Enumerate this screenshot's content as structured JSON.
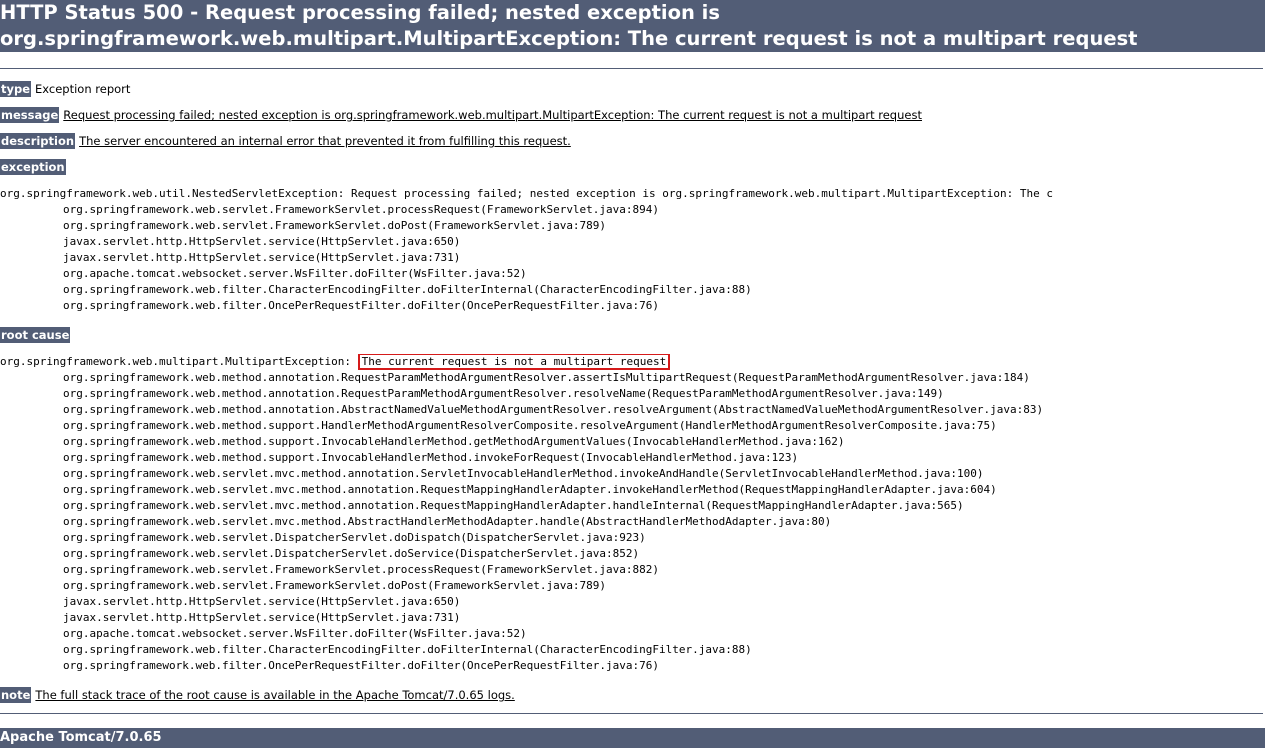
{
  "header": {
    "title_line1": "HTTP Status 500 - Request processing failed; nested exception is",
    "title_line2": "org.springframework.web.multipart.MultipartException: The current request is not a multipart request"
  },
  "report": {
    "type_label": "type",
    "type_value": "Exception report",
    "message_label": "message",
    "message_value": "Request processing failed; nested exception is org.springframework.web.multipart.MultipartException: The current request is not a multipart request",
    "description_label": "description",
    "description_value": "The server encountered an internal error that prevented it from fulfilling this request.",
    "exception_label": "exception",
    "root_cause_label": "root cause",
    "note_label": "note",
    "note_value": "The full stack trace of the root cause is available in the Apache Tomcat/7.0.65 logs."
  },
  "exception": {
    "first_line": "org.springframework.web.util.NestedServletException: Request processing failed; nested exception is org.springframework.web.multipart.MultipartException: The c",
    "frames": [
      "org.springframework.web.servlet.FrameworkServlet.processRequest(FrameworkServlet.java:894)",
      "org.springframework.web.servlet.FrameworkServlet.doPost(FrameworkServlet.java:789)",
      "javax.servlet.http.HttpServlet.service(HttpServlet.java:650)",
      "javax.servlet.http.HttpServlet.service(HttpServlet.java:731)",
      "org.apache.tomcat.websocket.server.WsFilter.doFilter(WsFilter.java:52)",
      "org.springframework.web.filter.CharacterEncodingFilter.doFilterInternal(CharacterEncodingFilter.java:88)",
      "org.springframework.web.filter.OncePerRequestFilter.doFilter(OncePerRequestFilter.java:76)"
    ]
  },
  "root_cause": {
    "first_line_prefix": "org.springframework.web.multipart.MultipartException: ",
    "first_line_highlight": "The current request is not a multipart request",
    "frames": [
      "org.springframework.web.method.annotation.RequestParamMethodArgumentResolver.assertIsMultipartRequest(RequestParamMethodArgumentResolver.java:184)",
      "org.springframework.web.method.annotation.RequestParamMethodArgumentResolver.resolveName(RequestParamMethodArgumentResolver.java:149)",
      "org.springframework.web.method.annotation.AbstractNamedValueMethodArgumentResolver.resolveArgument(AbstractNamedValueMethodArgumentResolver.java:83)",
      "org.springframework.web.method.support.HandlerMethodArgumentResolverComposite.resolveArgument(HandlerMethodArgumentResolverComposite.java:75)",
      "org.springframework.web.method.support.InvocableHandlerMethod.getMethodArgumentValues(InvocableHandlerMethod.java:162)",
      "org.springframework.web.method.support.InvocableHandlerMethod.invokeForRequest(InvocableHandlerMethod.java:123)",
      "org.springframework.web.servlet.mvc.method.annotation.ServletInvocableHandlerMethod.invokeAndHandle(ServletInvocableHandlerMethod.java:100)",
      "org.springframework.web.servlet.mvc.method.annotation.RequestMappingHandlerAdapter.invokeHandlerMethod(RequestMappingHandlerAdapter.java:604)",
      "org.springframework.web.servlet.mvc.method.annotation.RequestMappingHandlerAdapter.handleInternal(RequestMappingHandlerAdapter.java:565)",
      "org.springframework.web.servlet.mvc.method.AbstractHandlerMethodAdapter.handle(AbstractHandlerMethodAdapter.java:80)",
      "org.springframework.web.servlet.DispatcherServlet.doDispatch(DispatcherServlet.java:923)",
      "org.springframework.web.servlet.DispatcherServlet.doService(DispatcherServlet.java:852)",
      "org.springframework.web.servlet.FrameworkServlet.processRequest(FrameworkServlet.java:882)",
      "org.springframework.web.servlet.FrameworkServlet.doPost(FrameworkServlet.java:789)",
      "javax.servlet.http.HttpServlet.service(HttpServlet.java:650)",
      "javax.servlet.http.HttpServlet.service(HttpServlet.java:731)",
      "org.apache.tomcat.websocket.server.WsFilter.doFilter(WsFilter.java:52)",
      "org.springframework.web.filter.CharacterEncodingFilter.doFilterInternal(CharacterEncodingFilter.java:88)",
      "org.springframework.web.filter.OncePerRequestFilter.doFilter(OncePerRequestFilter.java:76)"
    ]
  },
  "footer": {
    "server_info": "Apache Tomcat/7.0.65"
  },
  "colors": {
    "bar_background": "#525d76",
    "bar_text": "#ffffff",
    "highlight_border": "#d51a1a"
  }
}
